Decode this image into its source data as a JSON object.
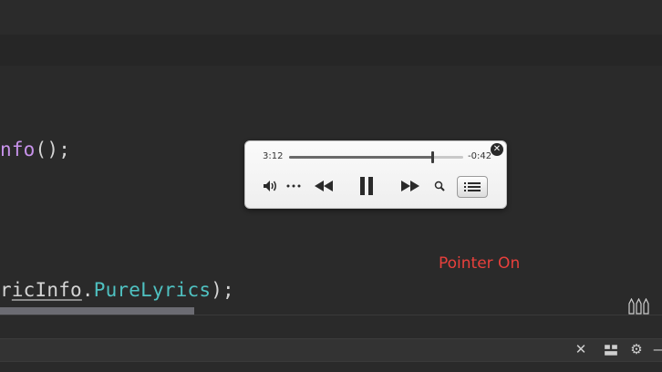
{
  "editor": {
    "line1": {
      "purple": "nfo",
      "rest": "();"
    },
    "line2": {
      "prefix": "r",
      "underlined": "icInfo",
      "dot": ".",
      "member": "PureLyrics",
      "rest": ");"
    }
  },
  "overlay": {
    "pointer_label": "Pointer On"
  },
  "mini_player": {
    "elapsed": "3:12",
    "remaining": "-0:42",
    "progress_fraction": 0.82,
    "icons": [
      "volume-icon",
      "more-icon",
      "rewind-icon",
      "pause-icon",
      "fast-forward-icon",
      "search-icon",
      "playlist-icon",
      "close-icon"
    ]
  },
  "bottom_bar": {
    "icons": [
      "close-icon",
      "layout-icon",
      "gear-icon",
      "minimize-icon"
    ]
  }
}
